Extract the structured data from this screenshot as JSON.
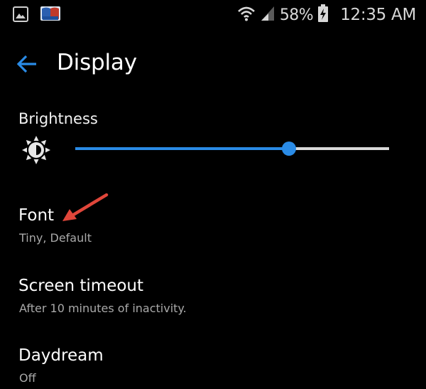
{
  "status_bar": {
    "battery_percent": "58%",
    "time": "12:35 AM",
    "icons": [
      "gallery-icon",
      "app-notification-icon",
      "wifi-icon",
      "signal-icon",
      "battery-charging-icon"
    ]
  },
  "header": {
    "title": "Display",
    "back_icon": "back-arrow-icon"
  },
  "brightness": {
    "label": "Brightness",
    "icon": "brightness-sun-icon",
    "level": 0.68
  },
  "settings": [
    {
      "title": "Font",
      "summary": "Tiny, Default"
    },
    {
      "title": "Screen timeout",
      "summary": "After 10 minutes of inactivity."
    },
    {
      "title": "Daydream",
      "summary": "Off"
    }
  ],
  "colors": {
    "accent": "#2a8be6",
    "background": "#000000",
    "annotation": "#e0463a"
  }
}
